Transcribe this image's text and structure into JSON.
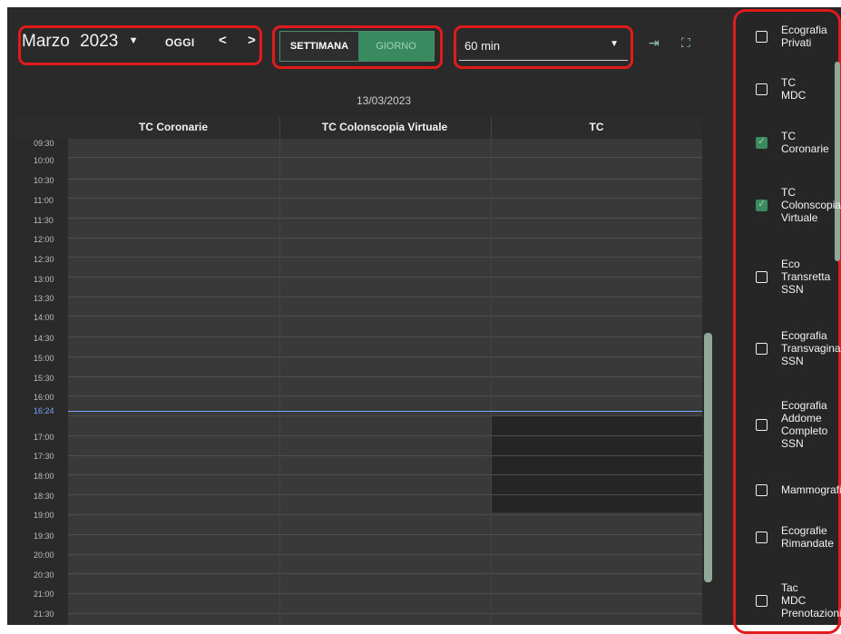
{
  "toolbar": {
    "month": "Marzo",
    "year": "2023",
    "today_label": "OGGI",
    "prev_label": "<",
    "next_label": ">",
    "view_week": "SETTIMANA",
    "view_day": "GIORNO",
    "slot_value": "60 min"
  },
  "calendar": {
    "date": "13/03/2023",
    "columns": [
      "TC Coronarie",
      "TC Colonscopia Virtuale",
      "TC"
    ],
    "times": [
      "09:30",
      "10:00",
      "10:30",
      "11:00",
      "11:30",
      "12:00",
      "12:30",
      "13:00",
      "13:30",
      "14:00",
      "14:30",
      "15:00",
      "15:30",
      "16:00",
      "17:00",
      "17:30",
      "18:00",
      "18:30",
      "19:00",
      "19:30",
      "20:00",
      "20:30",
      "21:00",
      "21:30"
    ],
    "now_time": "16:24"
  },
  "resources": [
    {
      "label": "Ecografia\nPrivati",
      "checked": false
    },
    {
      "label": "TC\nMDC",
      "checked": false
    },
    {
      "label": "TC\nCoronarie",
      "checked": true
    },
    {
      "label": "TC\nColonscopia\nVirtuale",
      "checked": true
    },
    {
      "label": "Eco\nTransretta\nSSN",
      "checked": false
    },
    {
      "label": "Ecografia\nTransvaginale\nSSN",
      "checked": false
    },
    {
      "label": "Ecografia\nAddome\nCompleto\nSSN",
      "checked": false
    },
    {
      "label": "Mammografia",
      "checked": false
    },
    {
      "label": "Ecografie\nRimandate",
      "checked": false
    },
    {
      "label": "Tac\nMDC\nPrenotazioni",
      "checked": false
    }
  ]
}
